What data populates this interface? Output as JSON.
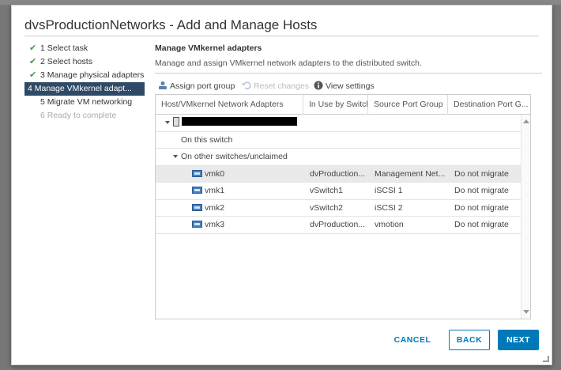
{
  "dialog": {
    "title": "dvsProductionNetworks - Add and Manage Hosts"
  },
  "steps": [
    {
      "label": "1 Select task",
      "state": "done"
    },
    {
      "label": "2 Select hosts",
      "state": "done"
    },
    {
      "label": "3 Manage physical adapters",
      "state": "done"
    },
    {
      "label": "4 Manage VMkernel adapt...",
      "state": "active"
    },
    {
      "label": "5 Migrate VM networking",
      "state": "pending"
    },
    {
      "label": "6 Ready to complete",
      "state": "disabled"
    }
  ],
  "page": {
    "title": "Manage VMkernel adapters",
    "subtitle": "Manage and assign VMkernel network adapters to the distributed switch."
  },
  "toolbar": {
    "assign": "Assign port group",
    "reset": "Reset changes",
    "view": "View settings"
  },
  "grid": {
    "columns": [
      "Host/VMkernel Network Adapters",
      "In Use by Switch",
      "Source Port Group",
      "Destination Port G..."
    ],
    "groups": {
      "on_switch": "On this switch",
      "other": "On other switches/unclaimed"
    },
    "rows": [
      {
        "adapter": "vmk0",
        "switch": "dvProduction...",
        "source": "Management Net...",
        "dest": "Do not migrate"
      },
      {
        "adapter": "vmk1",
        "switch": "vSwitch1",
        "source": "iSCSI 1",
        "dest": "Do not migrate"
      },
      {
        "adapter": "vmk2",
        "switch": "vSwitch2",
        "source": "iSCSI 2",
        "dest": "Do not migrate"
      },
      {
        "adapter": "vmk3",
        "switch": "dvProduction...",
        "source": "vmotion",
        "dest": "Do not migrate"
      }
    ]
  },
  "buttons": {
    "cancel": "CANCEL",
    "back": "BACK",
    "next": "NEXT"
  },
  "colors": {
    "accent": "#0079b8",
    "active_step": "#2f4a66",
    "check": "#3f9b3f"
  }
}
